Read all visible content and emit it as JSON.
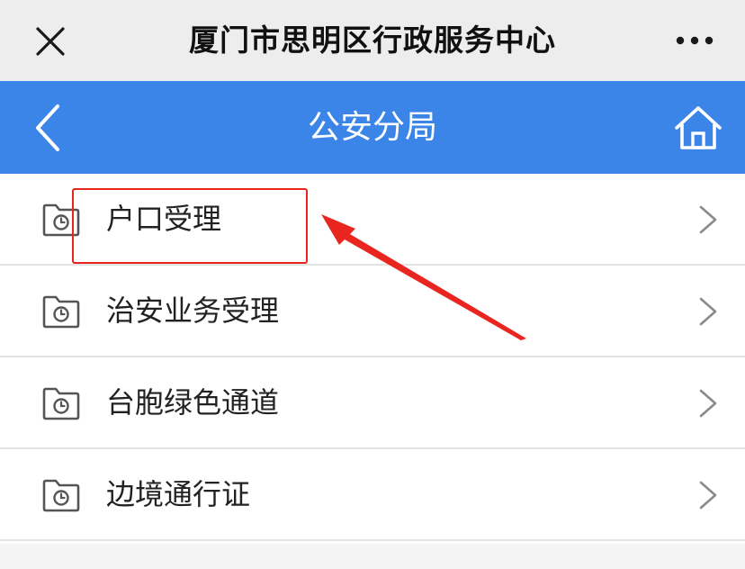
{
  "topbar": {
    "title": "厦门市思明区行政服务中心",
    "close_icon": "close-icon",
    "more_icon": "more-icon"
  },
  "header": {
    "title": "公安分局",
    "back_icon": "back-icon",
    "home_icon": "home-icon",
    "color": "#3b84e8"
  },
  "list": {
    "items": [
      {
        "label": "户口受理",
        "icon": "folder-clock-icon"
      },
      {
        "label": "治安业务受理",
        "icon": "folder-clock-icon"
      },
      {
        "label": "台胞绿色通道",
        "icon": "folder-clock-icon"
      },
      {
        "label": "边境通行证",
        "icon": "folder-clock-icon"
      }
    ]
  },
  "annotation": {
    "highlight_color": "#e8261f",
    "target_item": "户口受理"
  }
}
